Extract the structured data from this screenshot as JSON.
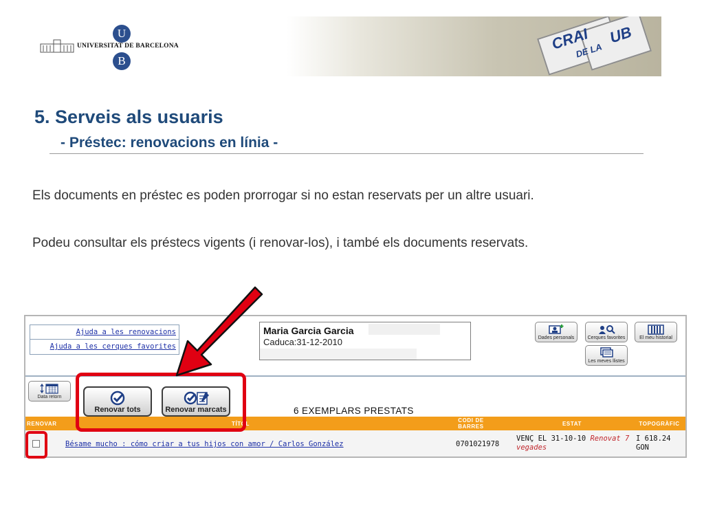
{
  "header": {
    "university_name": "UNIVERSITAT DE BARCELONA",
    "logo_letter_top": "U",
    "logo_letter_bottom": "B",
    "banner_word_1": "CRAI",
    "banner_word_2": "DE LA",
    "banner_word_3": "UB"
  },
  "slide": {
    "title": "5. Serveis als usuaris",
    "subtitle": "-  Préstec: renovacions en línia  -",
    "paragraph_1": "Els  documents en préstec es poden prorrogar si no estan reservats per un altre usuari.",
    "paragraph_2": "Podeu consultar els préstecs vigents (i renovar-los), i també els documents reservats."
  },
  "screenshot": {
    "help_links": [
      "Ajuda a les renovacions",
      "Ajuda a les cerques favorites"
    ],
    "user": {
      "name": "Maria Garcia Garcia",
      "expiry": "Caduca:31-12-2010"
    },
    "buttons": {
      "dades": "Dades personals",
      "cerques": "Cerques favorites",
      "historial": "El meu historial",
      "llistes": "Les meves llistes",
      "data_retorn": "Data retorn",
      "renovar_tots": "Renovar tots",
      "renovar_marcats": "Renovar marcats"
    },
    "items_count": "6 EXEMPLARS PRESTATS",
    "table": {
      "headers": {
        "renovar": "RENOVAR",
        "titol": "TÍTOL",
        "codi": "CODI DE BARRES",
        "estat": "ESTAT",
        "topografic": "TOPOGRÀFIC"
      },
      "rows": [
        {
          "title": "Bésame mucho : cómo criar a tus hijos con amor / Carlos González",
          "barcode": "0701021978",
          "due": "VENÇ EL 31-10-10",
          "renewed": "Renovat 7 vegades",
          "call_1": "I 618.24",
          "call_2": "GON"
        }
      ]
    }
  },
  "colors": {
    "title": "#1f4a7a",
    "annotation_red": "#e00012",
    "table_header": "#f39d1a",
    "link": "#1c2fa6"
  }
}
